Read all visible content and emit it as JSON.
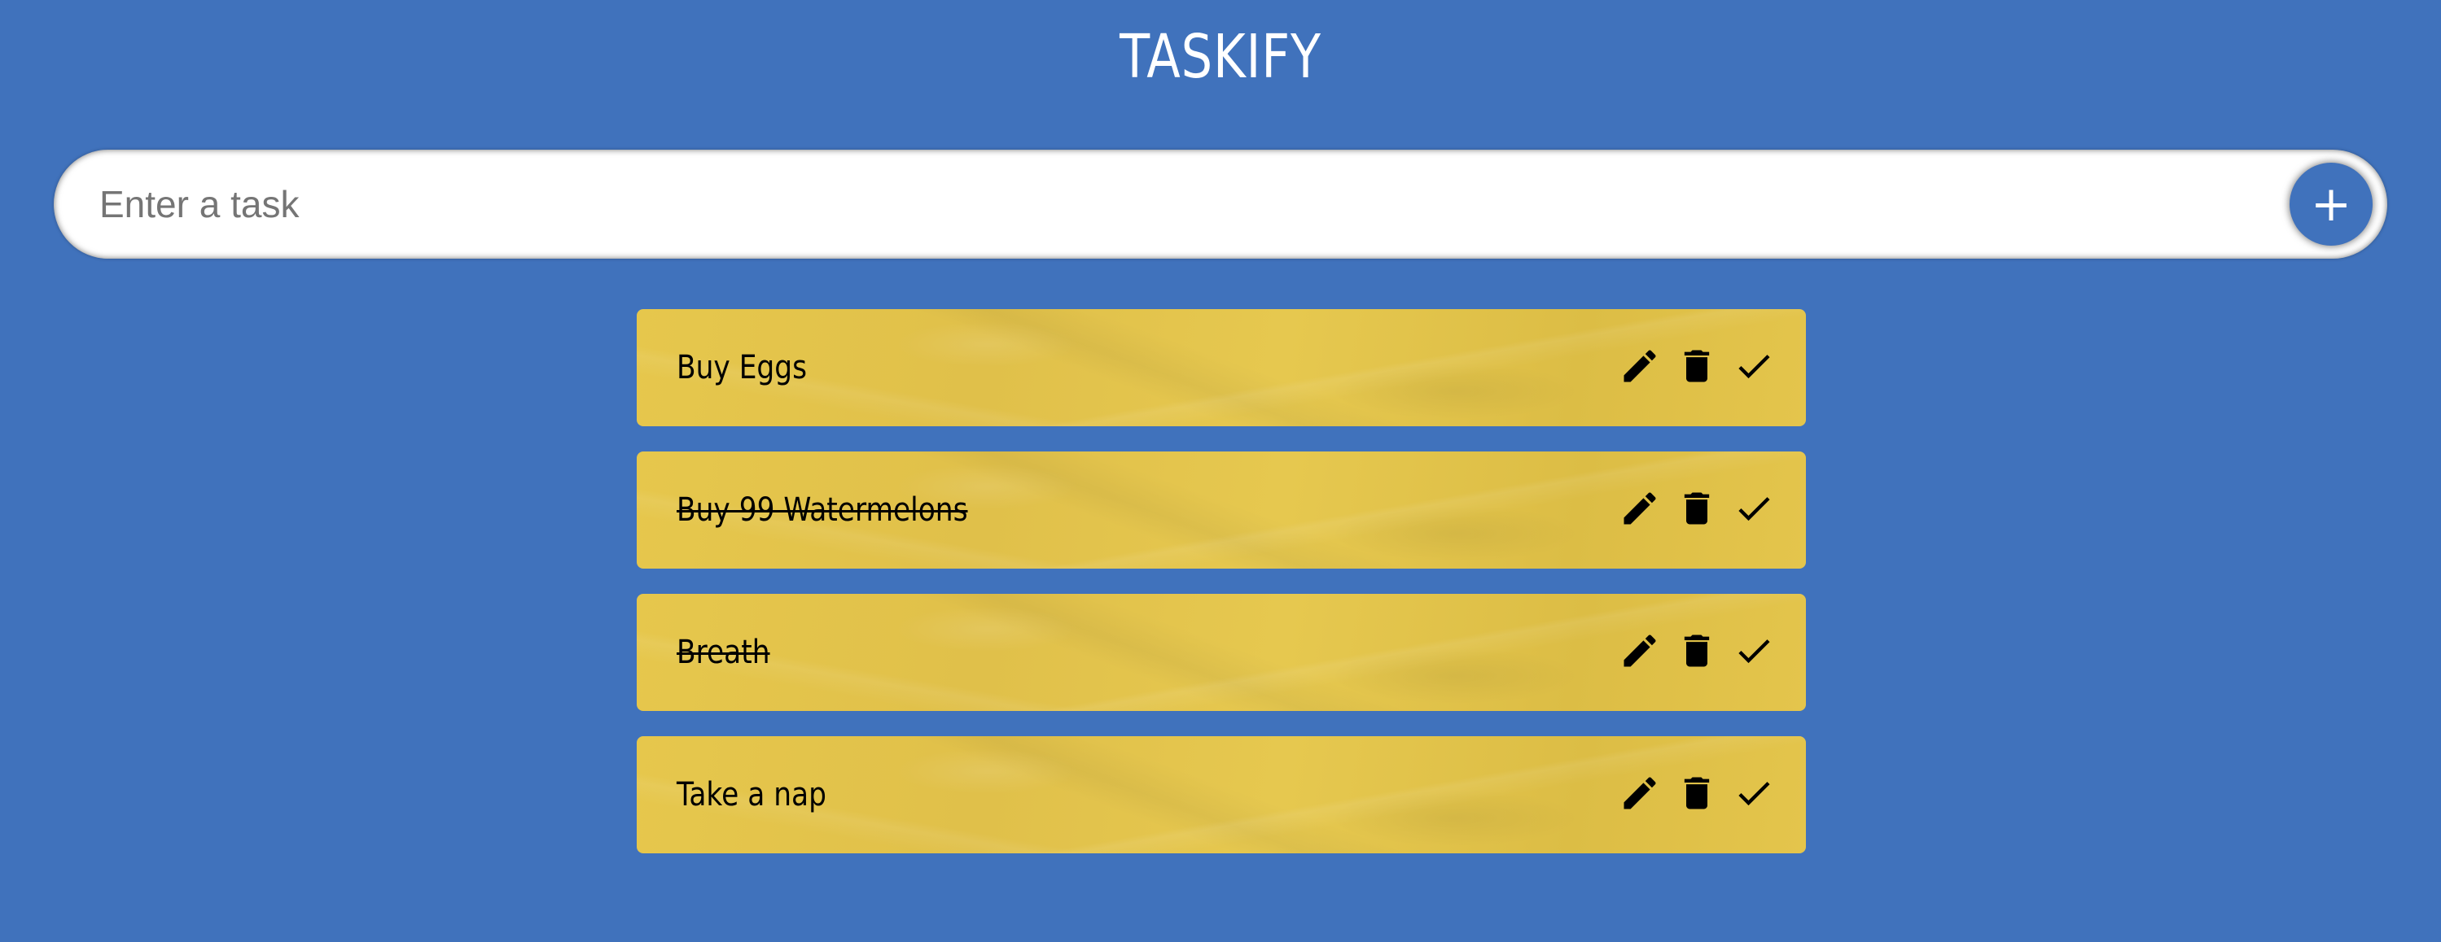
{
  "app": {
    "title": "TASKIFY"
  },
  "input": {
    "placeholder": "Enter a task",
    "value": "",
    "add_label": "+"
  },
  "colors": {
    "background": "#4072bc",
    "card": "#e4c54c",
    "text": "#000000"
  },
  "tasks": [
    {
      "text": "Buy Eggs",
      "done": false,
      "icons": [
        "pencil-icon",
        "trash-icon",
        "check-icon"
      ]
    },
    {
      "text": "Buy 99 Watermelons",
      "done": true,
      "icons": [
        "pencil-icon",
        "trash-icon",
        "check-icon"
      ]
    },
    {
      "text": "Breath",
      "done": true,
      "icons": [
        "pencil-icon",
        "trash-icon",
        "check-icon"
      ]
    },
    {
      "text": "Take a nap",
      "done": false,
      "icons": [
        "pencil-icon",
        "trash-icon",
        "check-icon"
      ]
    }
  ]
}
